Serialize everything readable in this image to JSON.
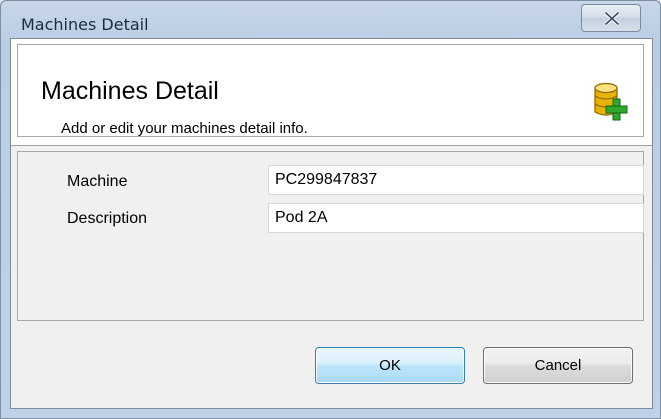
{
  "window": {
    "title": "Machines Detail"
  },
  "header": {
    "title": "Machines Detail",
    "subtitle": "Add or edit your machines detail info.",
    "icon": "database-add-icon"
  },
  "form": {
    "machine_label": "Machine",
    "machine_value": "PC299847837",
    "description_label": "Description",
    "description_value": "Pod 2A"
  },
  "buttons": {
    "ok_label": "OK",
    "cancel_label": "Cancel"
  },
  "colors": {
    "accent": "#3c7fb1",
    "icon_gold": "#e8b400",
    "icon_green": "#2ea82e"
  }
}
